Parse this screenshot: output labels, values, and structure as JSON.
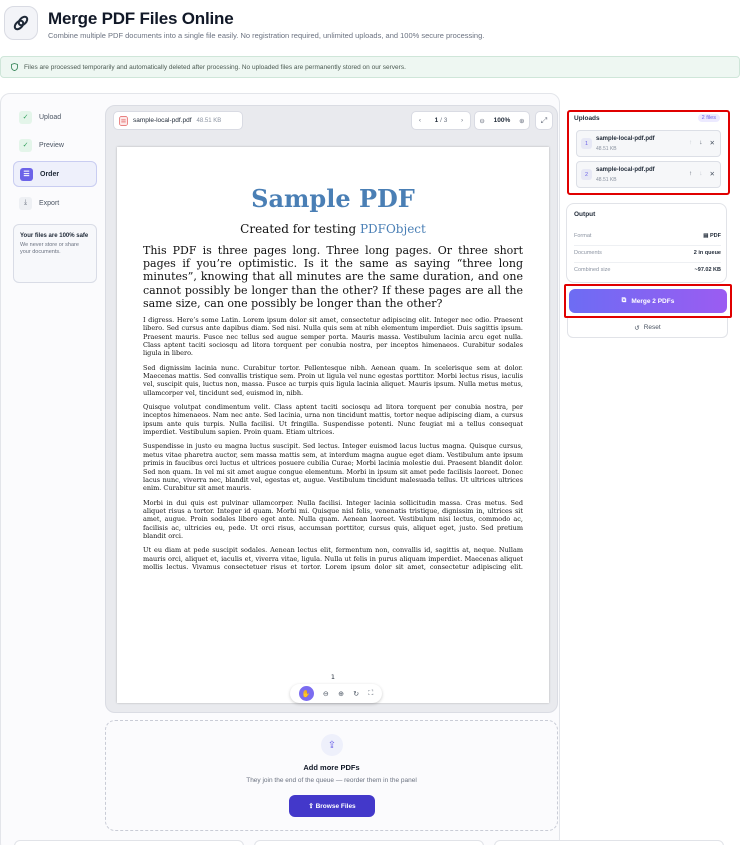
{
  "header": {
    "title": "Merge PDF Files Online",
    "subtitle": "Combine multiple PDF documents into a single file easily. No registration required, unlimited uploads, and 100% secure processing."
  },
  "notice": {
    "text": "Files are processed temporarily and automatically deleted after processing. No uploaded files are permanently stored on our servers."
  },
  "steps": [
    {
      "label": "Upload",
      "state": "done"
    },
    {
      "label": "Preview",
      "state": "done"
    },
    {
      "label": "Order",
      "state": "active"
    },
    {
      "label": "Export",
      "state": "pending"
    }
  ],
  "safe": {
    "title": "Your files are 100% safe",
    "text": "We never store or share your documents."
  },
  "viewer": {
    "file_name": "sample-local-pdf.pdf",
    "file_size": "48.51 KB",
    "page_current": "1",
    "page_separator": "/",
    "page_total": "3",
    "zoom": "100%",
    "page_number": "1"
  },
  "pdf": {
    "title": "Sample PDF",
    "subtitle_prefix": "Created for testing ",
    "subtitle_link": "PDFObject",
    "lead": "This PDF is three pages long. Three long pages. Or three short pages if you’re optimistic. Is it the same as saying “three long minutes”, knowing that all minutes are the same duration, and one cannot possibly be longer than the other? If these pages are all the same size, can one possibly be longer than the other?",
    "paragraphs": [
      "I digress. Here’s some Latin. Lorem ipsum dolor sit amet, consectetur adipiscing elit. Integer nec odio. Praesent libero. Sed cursus ante dapibus diam. Sed nisi. Nulla quis sem at nibh elementum imperdiet. Duis sagittis ipsum. Praesent mauris. Fusce nec tellus sed augue semper porta. Mauris massa. Vestibulum lacinia arcu eget nulla. Class aptent taciti sociosqu ad litora torquent per conubia nostra, per inceptos himenaeos. Curabitur sodales ligula in libero.",
      "Sed dignissim lacinia nunc. Curabitur tortor. Pellentesque nibh. Aenean quam. In scelerisque sem at dolor. Maecenas mattis. Sed convallis tristique sem. Proin ut ligula vel nunc egestas porttitor. Morbi lectus risus, iaculis vel, suscipit quis, luctus non, massa. Fusce ac turpis quis ligula lacinia aliquet. Mauris ipsum. Nulla metus metus, ullamcorper vel, tincidunt sed, euismod in, nibh.",
      "Quisque volutpat condimentum velit. Class aptent taciti sociosqu ad litora torquent per conubia nostra, per inceptos himenaeos. Nam nec ante. Sed lacinia, urna non tincidunt mattis, tortor neque adipiscing diam, a cursus ipsum ante quis turpis. Nulla facilisi. Ut fringilla. Suspendisse potenti. Nunc feugiat mi a tellus consequat imperdiet. Vestibulum sapien. Proin quam. Etiam ultrices.",
      "Suspendisse in justo eu magna luctus suscipit. Sed lectus. Integer euismod lacus luctus magna. Quisque cursus, metus vitae pharetra auctor, sem massa mattis sem, at interdum magna augue eget diam. Vestibulum ante ipsum primis in faucibus orci luctus et ultrices posuere cubilia Curae; Morbi lacinia molestie dui. Praesent blandit dolor. Sed non quam. In vel mi sit amet augue congue elementum. Morbi in ipsum sit amet pede facilisis laoreet. Donec lacus nunc, viverra nec, blandit vel, egestas et, augue. Vestibulum tincidunt malesuada tellus. Ut ultrices ultrices enim. Curabitur sit amet mauris.",
      "Morbi in dui quis est pulvinar ullamcorper. Nulla facilisi. Integer lacinia sollicitudin massa. Cras metus. Sed aliquet risus a tortor. Integer id quam. Morbi mi. Quisque nisl felis, venenatis tristique, dignissim in, ultrices sit amet, augue. Proin sodales libero eget ante. Nulla quam. Aenean laoreet. Vestibulum nisi lectus, commodo ac, facilisis ac, ultricies eu, pede. Ut orci risus, accumsan porttitor, cursus quis, aliquet eget, justo. Sed pretium blandit orci.",
      "Ut eu diam at pede suscipit sodales. Aenean lectus elit, fermentum non, convallis id, sagittis at, neque. Nullam mauris orci, aliquet et, iaculis et, viverra vitae, ligula. Nulla ut felis in purus aliquam imperdiet. Maecenas aliquet mollis lectus. Vivamus consectetuer risus et tortor. Lorem ipsum dolor sit amet, consectetur adipiscing elit. Integer nec odio. Praesent libero."
    ]
  },
  "addmore": {
    "title": "Add more PDFs",
    "subtitle": "They join the end of the queue — reorder them in the panel",
    "browse_label": "Browse Files"
  },
  "uploads": {
    "title": "Uploads",
    "badge": "2 files",
    "items": [
      {
        "index": "1",
        "name": "sample-local-pdf.pdf",
        "size": "48.51 KB"
      },
      {
        "index": "2",
        "name": "sample-local-pdf.pdf",
        "size": "48.51 KB"
      }
    ]
  },
  "output": {
    "title": "Output",
    "rows": [
      {
        "key": "Format",
        "value": "PDF"
      },
      {
        "key": "Documents",
        "value": "2 in queue"
      },
      {
        "key": "Combined size",
        "value": "~97.02 KB"
      }
    ]
  },
  "actions": {
    "merge_label": "Merge 2 PDFs",
    "reset_label": "Reset"
  },
  "colors": {
    "accent": "#6c63e8",
    "pdf_blue": "#4a7fb5",
    "highlight": "#e00000"
  }
}
